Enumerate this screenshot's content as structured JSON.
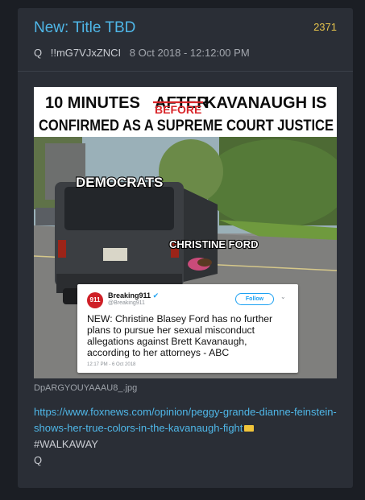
{
  "post": {
    "title": "New: Title TBD",
    "number": "2371",
    "author": "Q",
    "tripcode": "!!mG7VJxZNCI",
    "date": "8 Oct 2018 - 12:12:00 PM"
  },
  "image": {
    "caption_line1_a": "10 MINUTES",
    "caption_struck": "AFTER",
    "caption_inserted": "BEFORE",
    "caption_line1_b": "KAVANAUGH IS",
    "caption_line2": "CONFIRMED AS A SUPREME COURT JUSTICE",
    "label_car": "DEMOCRATS",
    "label_person": "CHRISTINE FORD",
    "filename": "DpARGYOUYAAAU8_.jpg"
  },
  "tweet": {
    "logo": "911",
    "name": "Breaking911",
    "handle": "@Breaking911",
    "follow": "Follow",
    "text": "NEW: Christine Blasey Ford has no further plans to pursue her sexual misconduct allegations against Brett Kavanaugh, according to her attorneys - ABC",
    "date": "12:17 PM - 6 Oct 2018"
  },
  "body": {
    "link": "https://www.foxnews.com/opinion/peggy-grande-dianne-feinstein-shows-her-true-colors-in-the-kavanaugh-fight",
    "hashtag": "#WALKAWAY",
    "sign": "Q"
  },
  "icons": {
    "folder": "folder-icon",
    "verified": "verified-icon",
    "chevron": "chevron-down-icon"
  },
  "colors": {
    "title": "#4fb7e8",
    "number": "#e6c44c",
    "link": "#4fb7e8",
    "text": "#c9ccd2",
    "card": "#2a2e36",
    "background": "#1b1e24"
  }
}
